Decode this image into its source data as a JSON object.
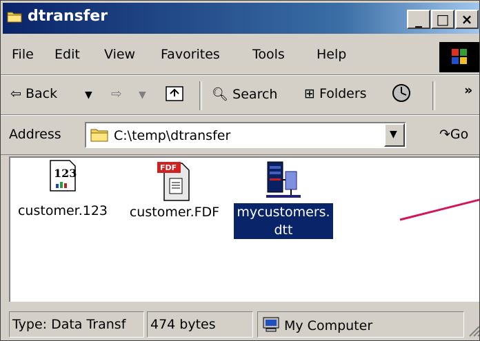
{
  "window": {
    "title": "dtransfer",
    "controls": {
      "minimize": "_",
      "maximize": "□",
      "close": "×"
    }
  },
  "menu": {
    "items": [
      "File",
      "Edit",
      "View",
      "Favorites",
      "Tools",
      "Help"
    ]
  },
  "toolbar": {
    "back_label": "Back",
    "search_label": "Search",
    "folders_label": "Folders",
    "more_label": "»"
  },
  "address": {
    "label": "Address",
    "value": "C:\\temp\\dtransfer",
    "go_label": "Go"
  },
  "files": [
    {
      "name": "customer.123",
      "icon": "lotus-123-file-icon",
      "selected": false
    },
    {
      "name": "customer.FDF",
      "icon": "fdf-file-icon",
      "selected": false
    },
    {
      "name_line1": "mycustomers.",
      "name_line2": "dtt",
      "icon": "data-transfer-file-icon",
      "selected": true
    }
  ],
  "status": {
    "type": "Type: Data Transf",
    "size": "474 bytes",
    "zone": "My Computer"
  },
  "colors": {
    "titlebar_start": "#0a246a",
    "titlebar_end": "#a6caf0",
    "chrome": "#d4d0c8",
    "selection": "#0a246a",
    "annotation_line": "#d4145a"
  }
}
